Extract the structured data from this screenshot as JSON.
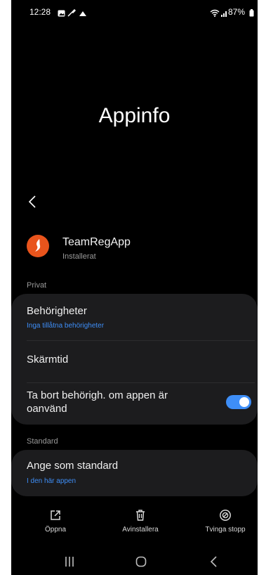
{
  "status_bar": {
    "time": "12:28",
    "battery": "87%"
  },
  "header": {
    "title": "Appinfo"
  },
  "app": {
    "name": "TeamRegApp",
    "status": "Installerat",
    "icon_color": "#e9541c"
  },
  "sections": {
    "private": "Privat",
    "standard": "Standard"
  },
  "rows": {
    "permissions_title": "Behörigheter",
    "permissions_sub": "Inga tillåtna behörigheter",
    "screen_time": "Skärmtid",
    "remove_perms_line1": "Ta bort behörigh. om appen är",
    "remove_perms_line2": "oanvänd",
    "remove_perms_enabled": true,
    "default_title": "Ange som standard",
    "default_sub": "I den här appen"
  },
  "actions": {
    "open": "Öppna",
    "uninstall": "Avinstallera",
    "force_stop": "Tvinga stopp"
  },
  "colors": {
    "accent": "#3e8ef7",
    "card": "#1c1c1e",
    "background": "#000000"
  }
}
